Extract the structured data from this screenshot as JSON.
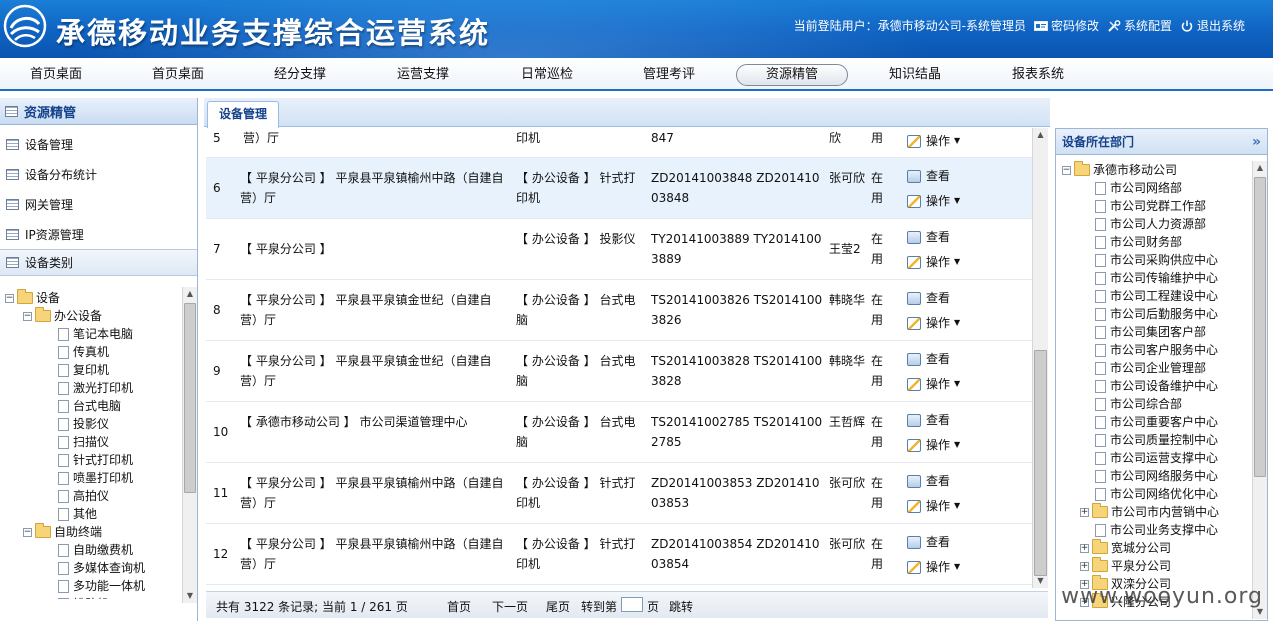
{
  "header": {
    "title": "承德移动业务支撑综合运营系统",
    "user_label": "当前登陆用户：承德市移动公司-系统管理员",
    "links": [
      {
        "label": "密码修改",
        "icon": "card-icon"
      },
      {
        "label": "系统配置",
        "icon": "tools-icon"
      },
      {
        "label": "退出系统",
        "icon": "power-icon"
      }
    ]
  },
  "nav": {
    "items": [
      "首页桌面",
      "首页桌面",
      "经分支撑",
      "运营支撑",
      "日常巡检",
      "管理考评",
      "资源精管",
      "知识结晶",
      "报表系统"
    ],
    "active": "资源精管"
  },
  "left": {
    "title": "资源精管",
    "menu": [
      "设备管理",
      "设备分布统计",
      "网关管理",
      "IP资源管理"
    ],
    "category_title": "设备类别",
    "tree": {
      "root": "设备",
      "office": "办公设备",
      "office_items": [
        "笔记本电脑",
        "传真机",
        "复印机",
        "激光打印机",
        "台式电脑",
        "投影仪",
        "扫描仪",
        "针式打印机",
        "喷墨打印机",
        "高拍仪",
        "其他"
      ],
      "terminal": "自助终端",
      "terminal_items": [
        "自助缴费机",
        "多媒体查询机",
        "多功能一体机",
        "排队机"
      ]
    }
  },
  "center": {
    "tab": "设备管理",
    "partial_row": {
      "idx": "5",
      "loc": "营）厅",
      "cat": "印机",
      "code": "847",
      "user": "欣",
      "status": "用"
    },
    "rows": [
      {
        "idx": "6",
        "loc": "【 平泉分公司 】 平泉县平泉镇榆州中路（自建自营）厅",
        "cat": "【 办公设备 】 针式打印机",
        "code": "ZD20141003848 ZD20141003848",
        "user": "张可欣",
        "status": "在用"
      },
      {
        "idx": "7",
        "loc": "【 平泉分公司 】",
        "cat": "【 办公设备 】 投影仪",
        "code": "TY20141003889 TY20141003889",
        "user": "王莹2",
        "status": "在用"
      },
      {
        "idx": "8",
        "loc": "【 平泉分公司 】 平泉县平泉镇金世纪（自建自营）厅",
        "cat": "【 办公设备 】 台式电脑",
        "code": "TS20141003826 TS20141003826",
        "user": "韩晓华",
        "status": "在用"
      },
      {
        "idx": "9",
        "loc": "【 平泉分公司 】 平泉县平泉镇金世纪（自建自营）厅",
        "cat": "【 办公设备 】 台式电脑",
        "code": "TS20141003828 TS20141003828",
        "user": "韩晓华",
        "status": "在用"
      },
      {
        "idx": "10",
        "loc": "【 承德市移动公司 】 市公司渠道管理中心",
        "cat": "【 办公设备 】 台式电脑",
        "code": "TS20141002785 TS20141002785",
        "user": "王哲辉",
        "status": "在用"
      },
      {
        "idx": "11",
        "loc": "【 平泉分公司 】 平泉县平泉镇榆州中路（自建自营）厅",
        "cat": "【 办公设备 】 针式打印机",
        "code": "ZD20141003853 ZD20141003853",
        "user": "张可欣",
        "status": "在用"
      },
      {
        "idx": "12",
        "loc": "【 平泉分公司 】 平泉县平泉镇榆州中路（自建自营）厅",
        "cat": "【 办公设备 】 针式打印机",
        "code": "ZD20141003854 ZD20141003854",
        "user": "张可欣",
        "status": "在用"
      }
    ],
    "op_view": "查看",
    "op_menu": "操作",
    "pager": {
      "summary": "共有 3122 条记录; 当前 1 / 261 页",
      "first": "首页",
      "next": "下一页",
      "last": "尾页",
      "goto": "转到第",
      "page_unit": "页",
      "jump": "跳转"
    }
  },
  "right": {
    "title": "设备所在部门",
    "root": "承德市移动公司",
    "departments": [
      "市公司网络部",
      "市公司党群工作部",
      "市公司人力资源部",
      "市公司财务部",
      "市公司采购供应中心",
      "市公司传输维护中心",
      "市公司工程建设中心",
      "市公司后勤服务中心",
      "市公司集团客户部",
      "市公司客户服务中心",
      "市公司企业管理部",
      "市公司设备维护中心",
      "市公司综合部",
      "市公司重要客户中心",
      "市公司质量控制中心",
      "市公司运营支撑中心",
      "市公司网络服务中心",
      "市公司网络优化中心"
    ],
    "dept_expandable": "市公司市内营销中心",
    "dept_last": "市公司业务支撑中心",
    "branches": [
      "宽城分公司",
      "平泉分公司",
      "双滦分公司",
      "兴隆分公司"
    ]
  },
  "watermark": "www.wooyun.org",
  "colors": {
    "header_blue": "#0f62c2",
    "panel_title": "#15428b",
    "row_highlight": "#e8f2fc"
  }
}
